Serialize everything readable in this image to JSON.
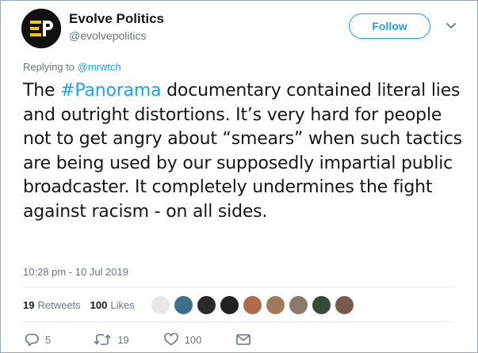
{
  "author": {
    "name": "Evolve Politics",
    "handle": "@evolvepolitics",
    "avatar_colors": {
      "bg": "#111111",
      "mark": "#f5c518"
    }
  },
  "header": {
    "follow_label": "Follow"
  },
  "reply": {
    "prefix": "Replying to ",
    "to_handle": "@mrwtch"
  },
  "tweet": {
    "text_before": "The ",
    "hashtag": "#Panorama",
    "text_after": " documentary contained literal lies and outright distortions. It’s very hard for people not to get angry about “smears” when such tactics are being used by our supposedly impartial public broadcaster. It completely undermines the fight against racism - on all sides.",
    "timestamp": "10:28 pm - 10 Jul 2019"
  },
  "stats": {
    "retweets_count": "19",
    "retweets_label": "Retweets",
    "likes_count": "100",
    "likes_label": "Likes",
    "liker_colors": [
      "#e8e8e8",
      "#3f6f8f",
      "#2a2a2a",
      "#222222",
      "#b06a4a",
      "#a07a5a",
      "#8a7a6a",
      "#3a4a3a",
      "#7a5a4a"
    ]
  },
  "actions": {
    "reply_count": "5",
    "retweet_count": "19",
    "like_count": "100"
  },
  "colors": {
    "accent": "#1da1f2",
    "text": "#14171a",
    "muted": "#657786"
  }
}
